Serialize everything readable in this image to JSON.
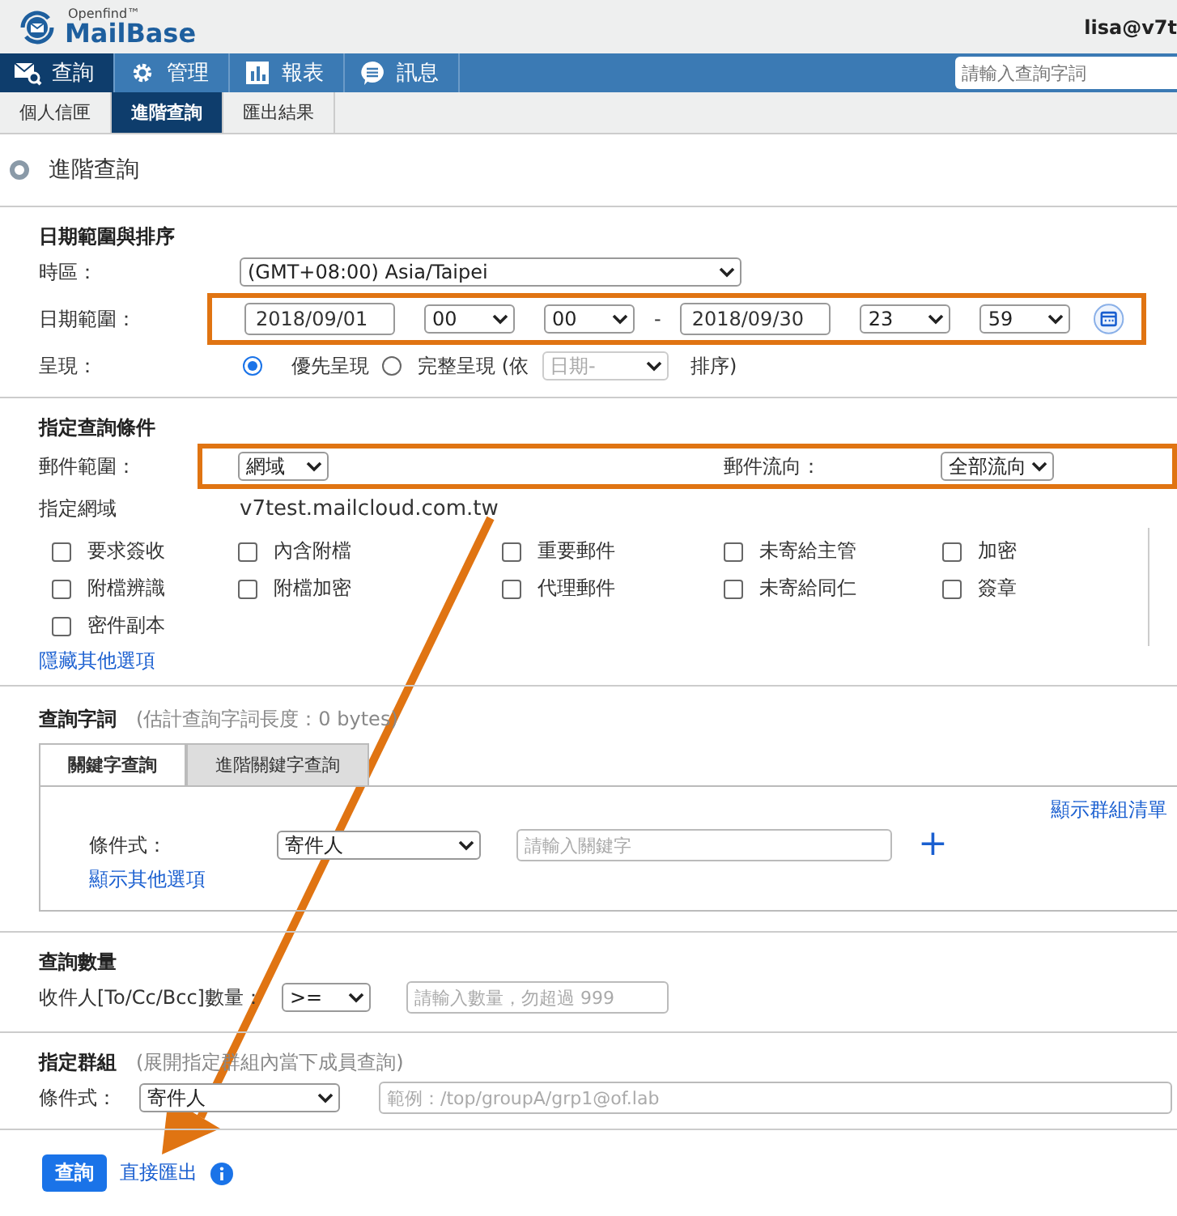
{
  "header": {
    "logo_small": "Openfind™",
    "logo_name": "MailBase",
    "user": "lisa@v7t"
  },
  "nav": {
    "tabs": [
      {
        "label": "查詢",
        "selected": true
      },
      {
        "label": "管理",
        "selected": false
      },
      {
        "label": "報表",
        "selected": false
      },
      {
        "label": "訊息",
        "selected": false
      }
    ],
    "search": {
      "placeholder": "請輸入查詢字詞"
    }
  },
  "subnav": [
    {
      "label": "個人信匣",
      "selected": false
    },
    {
      "label": "進階查詢",
      "selected": true
    },
    {
      "label": "匯出結果",
      "selected": false
    }
  ],
  "page_title": "進階查詢",
  "date_section": {
    "title": "日期範圍與排序",
    "timezone_label": "時區：",
    "timezone": "(GMT+08:00) Asia/Taipei",
    "range_label": "日期範圍：",
    "start_date": "2018/09/01",
    "start_hour": "00",
    "start_minute": "00",
    "separator": "-",
    "end_date": "2018/09/30",
    "end_hour": "23",
    "end_minute": "59",
    "display_label": "呈現：",
    "display_options": [
      {
        "label": "優先呈現",
        "selected": true
      },
      {
        "label": "完整呈現 (依",
        "selected": false
      }
    ],
    "sort_select": "日期-",
    "sort_suffix": "排序)"
  },
  "condition_section": {
    "title": "指定查詢條件",
    "scope_label": "郵件範圍：",
    "scope": "網域",
    "direction_label": "郵件流向：",
    "direction": "全部流向",
    "domain_label": "指定網域",
    "domain": "v7test.mailcloud.com.tw",
    "options": [
      {
        "label": "要求簽收",
        "checked": false
      },
      {
        "label": "內含附檔",
        "checked": false
      },
      {
        "label": "重要郵件",
        "checked": false
      },
      {
        "label": "未寄給主管",
        "checked": false
      },
      {
        "label": "加密",
        "checked": false
      },
      {
        "label": "附檔辨識",
        "checked": false
      },
      {
        "label": "附檔加密",
        "checked": false
      },
      {
        "label": "代理郵件",
        "checked": false
      },
      {
        "label": "未寄給同仁",
        "checked": false
      },
      {
        "label": "簽章",
        "checked": false
      },
      {
        "label": "密件副本",
        "checked": false
      }
    ],
    "toggle_link": "隱藏其他選項"
  },
  "term_section": {
    "title": "查詢字詞",
    "hint": "(估計查詢字詞長度：0 bytes)",
    "tabs": [
      {
        "label": "關鍵字查詢",
        "selected": true
      },
      {
        "label": "進階關鍵字查詢",
        "selected": false
      }
    ],
    "group_list_link": "顯示群組清單",
    "condition_label": "條件式：",
    "field": "寄件人",
    "keyword": {
      "placeholder": "請輸入關鍵字"
    },
    "add": "+",
    "more_link": "顯示其他選項"
  },
  "count_section": {
    "title": "查詢數量",
    "label": "收件人[To/Cc/Bcc]數量：",
    "operator": ">=",
    "count": {
      "placeholder": "請輸入數量，勿超過 999"
    }
  },
  "group_section": {
    "title": "指定群組",
    "hint": "(展開指定群組內當下成員查詢)",
    "label": "條件式：",
    "field": "寄件人",
    "group": {
      "placeholder": "範例：/top/groupA/grp1@of.lab"
    }
  },
  "actions": {
    "search_button": "查詢",
    "export_link": "直接匯出"
  }
}
